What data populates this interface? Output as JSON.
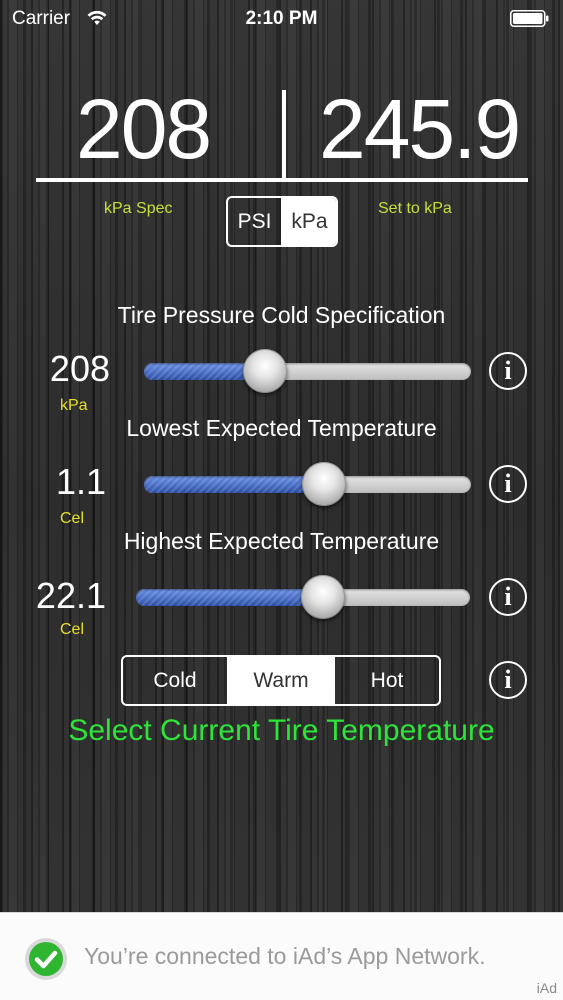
{
  "status_bar": {
    "carrier": "Carrier",
    "time": "2:10 PM"
  },
  "readout": {
    "spec_value": "208",
    "set_value": "245.9",
    "spec_label": "kPa Spec",
    "set_label": "Set to kPa"
  },
  "unit_toggle": {
    "options": [
      "PSI",
      "kPa"
    ],
    "selected": "kPa"
  },
  "sliders": [
    {
      "title": "Tire Pressure Cold Specification",
      "value": "208",
      "unit": "kPa",
      "fraction": 0.37
    },
    {
      "title": "Lowest Expected Temperature",
      "value": "1.1",
      "unit": "Cel",
      "fraction": 0.55
    },
    {
      "title": "Highest Expected Temperature",
      "value": "22.1",
      "unit": "Cel",
      "fraction": 0.56
    }
  ],
  "info_symbol": "i",
  "temperature_toggle": {
    "options": [
      "Cold",
      "Warm",
      "Hot"
    ],
    "selected": "Warm"
  },
  "hint": "Select Current Tire Temperature",
  "ad": {
    "message": "You’re connected to iAd’s App Network.",
    "badge": "iAd"
  },
  "colors": {
    "label_green": "#c6e03a",
    "unit_yellow": "#e6e02a",
    "hint_green": "#2ee43a",
    "slider_blue": "#3d66c4"
  }
}
